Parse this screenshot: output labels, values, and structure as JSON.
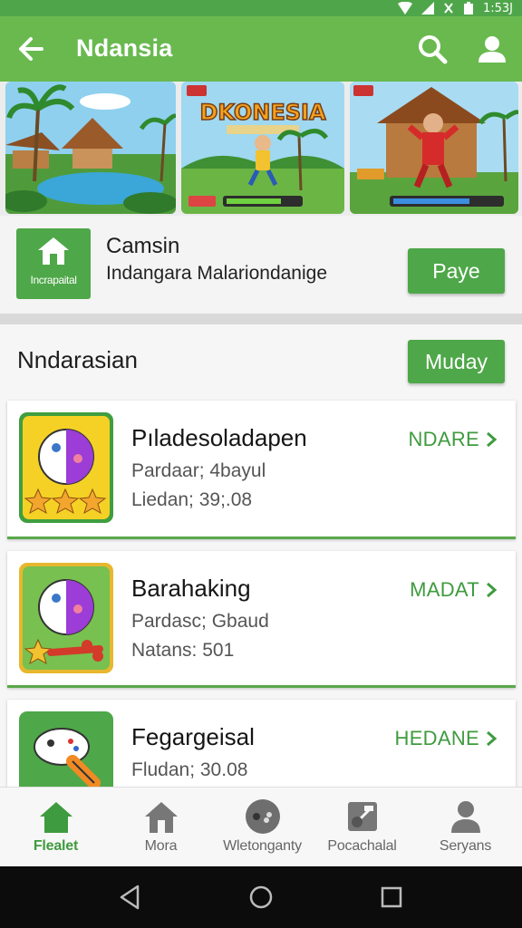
{
  "status_bar": {
    "time": "1:53J"
  },
  "app_bar": {
    "title": "Ndansia"
  },
  "banners": [
    {
      "name": "banner-temple-lake"
    },
    {
      "name": "banner-dkonesia",
      "title_text": "DKONESIA"
    },
    {
      "name": "banner-fighter"
    }
  ],
  "promo": {
    "icon_label": "Incrapaital",
    "name": "Camsin",
    "subtitle": "Indangara Malariondanige",
    "button_label": "Paye"
  },
  "section": {
    "heading": "Nndarasian",
    "button_label": "Muday",
    "items": [
      {
        "name": "Pıladesoladapen",
        "line1": "Pardaar; 4bayul",
        "line2": "Liedan; 39;.08",
        "tag": "NDARE"
      },
      {
        "name": "Barahaking",
        "line1": "Pardasc; Gbaud",
        "line2": "Natans: 501",
        "tag": "MADAT"
      },
      {
        "name": "Fegargeisal",
        "line1": "Fludan; 30.08",
        "line2": "",
        "tag": "HEDANE"
      }
    ]
  },
  "bottom_nav": [
    {
      "label": "Flealet",
      "icon": "home-icon",
      "active": true
    },
    {
      "label": "Mora",
      "icon": "house-outline-icon",
      "active": false
    },
    {
      "label": "Wletonganty",
      "icon": "gamepad-icon",
      "active": false
    },
    {
      "label": "Pocachalal",
      "icon": "puzzle-icon",
      "active": false
    },
    {
      "label": "Seryans",
      "icon": "person-icon",
      "active": false
    }
  ],
  "colors": {
    "primary": "#69b94f",
    "button": "#4ea748",
    "accent_text": "#3f9b3f",
    "status_bar": "#4fa64a"
  }
}
